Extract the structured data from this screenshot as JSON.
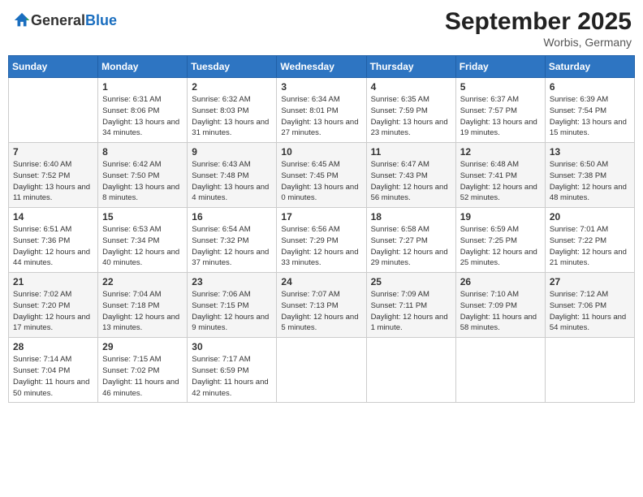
{
  "header": {
    "logo_general": "General",
    "logo_blue": "Blue",
    "month_year": "September 2025",
    "location": "Worbis, Germany"
  },
  "weekdays": [
    "Sunday",
    "Monday",
    "Tuesday",
    "Wednesday",
    "Thursday",
    "Friday",
    "Saturday"
  ],
  "weeks": [
    [
      {
        "day": "",
        "sunrise": "",
        "sunset": "",
        "daylight": ""
      },
      {
        "day": "1",
        "sunrise": "Sunrise: 6:31 AM",
        "sunset": "Sunset: 8:06 PM",
        "daylight": "Daylight: 13 hours and 34 minutes."
      },
      {
        "day": "2",
        "sunrise": "Sunrise: 6:32 AM",
        "sunset": "Sunset: 8:03 PM",
        "daylight": "Daylight: 13 hours and 31 minutes."
      },
      {
        "day": "3",
        "sunrise": "Sunrise: 6:34 AM",
        "sunset": "Sunset: 8:01 PM",
        "daylight": "Daylight: 13 hours and 27 minutes."
      },
      {
        "day": "4",
        "sunrise": "Sunrise: 6:35 AM",
        "sunset": "Sunset: 7:59 PM",
        "daylight": "Daylight: 13 hours and 23 minutes."
      },
      {
        "day": "5",
        "sunrise": "Sunrise: 6:37 AM",
        "sunset": "Sunset: 7:57 PM",
        "daylight": "Daylight: 13 hours and 19 minutes."
      },
      {
        "day": "6",
        "sunrise": "Sunrise: 6:39 AM",
        "sunset": "Sunset: 7:54 PM",
        "daylight": "Daylight: 13 hours and 15 minutes."
      }
    ],
    [
      {
        "day": "7",
        "sunrise": "Sunrise: 6:40 AM",
        "sunset": "Sunset: 7:52 PM",
        "daylight": "Daylight: 13 hours and 11 minutes."
      },
      {
        "day": "8",
        "sunrise": "Sunrise: 6:42 AM",
        "sunset": "Sunset: 7:50 PM",
        "daylight": "Daylight: 13 hours and 8 minutes."
      },
      {
        "day": "9",
        "sunrise": "Sunrise: 6:43 AM",
        "sunset": "Sunset: 7:48 PM",
        "daylight": "Daylight: 13 hours and 4 minutes."
      },
      {
        "day": "10",
        "sunrise": "Sunrise: 6:45 AM",
        "sunset": "Sunset: 7:45 PM",
        "daylight": "Daylight: 13 hours and 0 minutes."
      },
      {
        "day": "11",
        "sunrise": "Sunrise: 6:47 AM",
        "sunset": "Sunset: 7:43 PM",
        "daylight": "Daylight: 12 hours and 56 minutes."
      },
      {
        "day": "12",
        "sunrise": "Sunrise: 6:48 AM",
        "sunset": "Sunset: 7:41 PM",
        "daylight": "Daylight: 12 hours and 52 minutes."
      },
      {
        "day": "13",
        "sunrise": "Sunrise: 6:50 AM",
        "sunset": "Sunset: 7:38 PM",
        "daylight": "Daylight: 12 hours and 48 minutes."
      }
    ],
    [
      {
        "day": "14",
        "sunrise": "Sunrise: 6:51 AM",
        "sunset": "Sunset: 7:36 PM",
        "daylight": "Daylight: 12 hours and 44 minutes."
      },
      {
        "day": "15",
        "sunrise": "Sunrise: 6:53 AM",
        "sunset": "Sunset: 7:34 PM",
        "daylight": "Daylight: 12 hours and 40 minutes."
      },
      {
        "day": "16",
        "sunrise": "Sunrise: 6:54 AM",
        "sunset": "Sunset: 7:32 PM",
        "daylight": "Daylight: 12 hours and 37 minutes."
      },
      {
        "day": "17",
        "sunrise": "Sunrise: 6:56 AM",
        "sunset": "Sunset: 7:29 PM",
        "daylight": "Daylight: 12 hours and 33 minutes."
      },
      {
        "day": "18",
        "sunrise": "Sunrise: 6:58 AM",
        "sunset": "Sunset: 7:27 PM",
        "daylight": "Daylight: 12 hours and 29 minutes."
      },
      {
        "day": "19",
        "sunrise": "Sunrise: 6:59 AM",
        "sunset": "Sunset: 7:25 PM",
        "daylight": "Daylight: 12 hours and 25 minutes."
      },
      {
        "day": "20",
        "sunrise": "Sunrise: 7:01 AM",
        "sunset": "Sunset: 7:22 PM",
        "daylight": "Daylight: 12 hours and 21 minutes."
      }
    ],
    [
      {
        "day": "21",
        "sunrise": "Sunrise: 7:02 AM",
        "sunset": "Sunset: 7:20 PM",
        "daylight": "Daylight: 12 hours and 17 minutes."
      },
      {
        "day": "22",
        "sunrise": "Sunrise: 7:04 AM",
        "sunset": "Sunset: 7:18 PM",
        "daylight": "Daylight: 12 hours and 13 minutes."
      },
      {
        "day": "23",
        "sunrise": "Sunrise: 7:06 AM",
        "sunset": "Sunset: 7:15 PM",
        "daylight": "Daylight: 12 hours and 9 minutes."
      },
      {
        "day": "24",
        "sunrise": "Sunrise: 7:07 AM",
        "sunset": "Sunset: 7:13 PM",
        "daylight": "Daylight: 12 hours and 5 minutes."
      },
      {
        "day": "25",
        "sunrise": "Sunrise: 7:09 AM",
        "sunset": "Sunset: 7:11 PM",
        "daylight": "Daylight: 12 hours and 1 minute."
      },
      {
        "day": "26",
        "sunrise": "Sunrise: 7:10 AM",
        "sunset": "Sunset: 7:09 PM",
        "daylight": "Daylight: 11 hours and 58 minutes."
      },
      {
        "day": "27",
        "sunrise": "Sunrise: 7:12 AM",
        "sunset": "Sunset: 7:06 PM",
        "daylight": "Daylight: 11 hours and 54 minutes."
      }
    ],
    [
      {
        "day": "28",
        "sunrise": "Sunrise: 7:14 AM",
        "sunset": "Sunset: 7:04 PM",
        "daylight": "Daylight: 11 hours and 50 minutes."
      },
      {
        "day": "29",
        "sunrise": "Sunrise: 7:15 AM",
        "sunset": "Sunset: 7:02 PM",
        "daylight": "Daylight: 11 hours and 46 minutes."
      },
      {
        "day": "30",
        "sunrise": "Sunrise: 7:17 AM",
        "sunset": "Sunset: 6:59 PM",
        "daylight": "Daylight: 11 hours and 42 minutes."
      },
      {
        "day": "",
        "sunrise": "",
        "sunset": "",
        "daylight": ""
      },
      {
        "day": "",
        "sunrise": "",
        "sunset": "",
        "daylight": ""
      },
      {
        "day": "",
        "sunrise": "",
        "sunset": "",
        "daylight": ""
      },
      {
        "day": "",
        "sunrise": "",
        "sunset": "",
        "daylight": ""
      }
    ]
  ]
}
